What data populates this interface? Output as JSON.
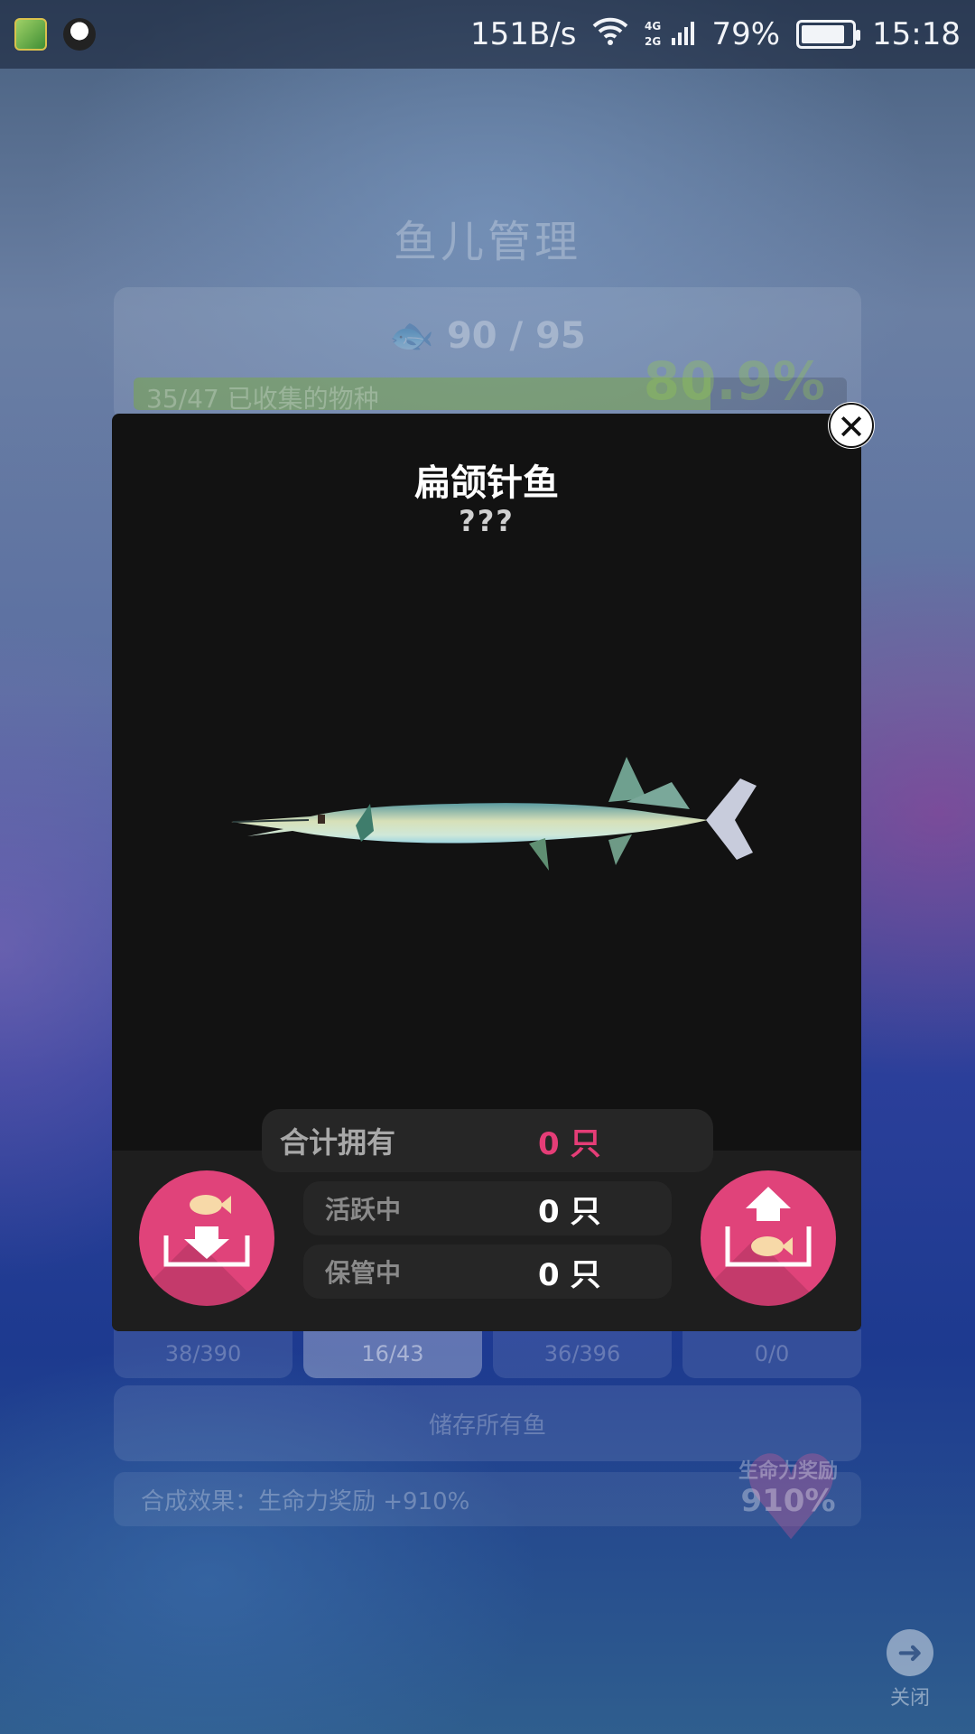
{
  "status_bar": {
    "net_speed": "151B/s",
    "signal": "4G 2G",
    "battery_percent": "79%",
    "battery_level": 0.79,
    "time": "15:18"
  },
  "background": {
    "title": "鱼儿管理",
    "fish_count": "90 / 95",
    "progress_text": "35/47 已收集的物种",
    "progress_percent": "80.9%",
    "progress_value": 0.809,
    "tabs": [
      "38/390",
      "16/43",
      "36/396",
      "0/0"
    ],
    "active_tab_index": 1,
    "store_all_label": "储存所有鱼",
    "effect_text": "合成效果：生命力奖励 +910%",
    "heart_badge": {
      "label": "生命力奖励",
      "value": "910%"
    },
    "close_label": "关闭"
  },
  "modal": {
    "fish_name": "扁颌针鱼",
    "fish_subtitle": "???",
    "total_label": "合计拥有",
    "total_value": "0 只",
    "active_label": "活跃中",
    "active_value": "0 只",
    "stored_label": "保管中",
    "stored_value": "0 只"
  },
  "colors": {
    "accent_pink": "#e0437a",
    "total_value_pink": "#e53d77",
    "modal_bg": "#121212",
    "progress_green": "#8cbe5a"
  },
  "icons": [
    "close-icon",
    "store-fish-icon",
    "release-fish-icon",
    "fish-icon",
    "heart-icon",
    "arrow-right-icon",
    "wifi-icon",
    "battery-icon"
  ]
}
